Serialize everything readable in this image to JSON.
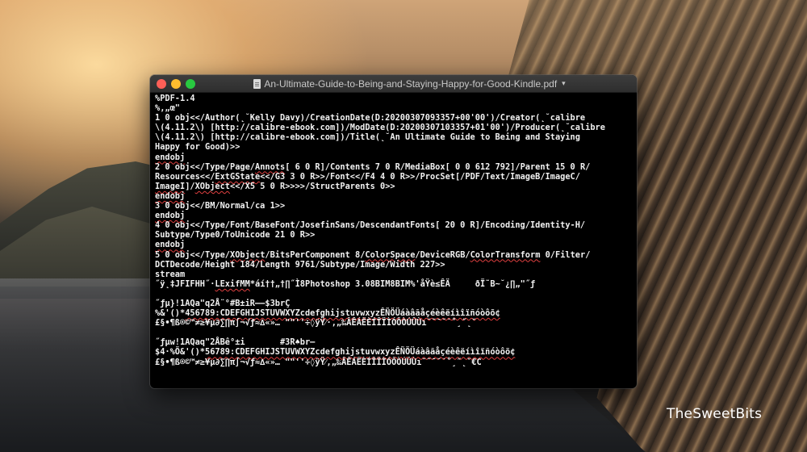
{
  "window": {
    "title": "An-Ultimate-Guide-to-Being-and-Staying-Happy-for-Good-Kindle.pdf",
    "title_icon": "document-icon",
    "dropdown_icon": "chevron-down-icon"
  },
  "watermark": "TheSweetBits",
  "colors": {
    "terminal_bg": "#000000",
    "terminal_text": "#f2f2f2",
    "close": "#fe5f57",
    "minimize": "#febc2e",
    "zoom": "#28c840",
    "spellcheck_underline": "#e04040"
  },
  "terminal_lines": [
    [
      "%PDF-1.4"
    ],
    [
      "%‚„œ\""
    ],
    [
      "1 0 obj<</Author(˛˘Kelly Davy)/CreationDate(D:20200307093357+00'00')/Creator(˛˘calibre"
    ],
    [
      "\\(4.11.2\\) [http://calibre-ebook.com])/ModDate(D:20200307103357+01'00')/Producer(˛˘calibre"
    ],
    [
      "\\(4.11.2\\) [http://calibre-ebook.com])/Title(˛˘An Ultimate Guide to Being and Staying"
    ],
    [
      "Happy for Good)>>"
    ],
    [
      {
        "t": "endobj",
        "sq": true
      }
    ],
    [
      "2 0 obj<</Type/Page/",
      {
        "t": "Annots",
        "sq": true
      },
      "[ 6 0 R]/Contents 7 0 R/MediaBox[ 0 0 612 792]/Parent 15 0 R/"
    ],
    [
      "Resources<</",
      {
        "t": "ExtGState",
        "sq": true
      },
      "<</G3 3 0 R>>/Font<</F4 4 0 R>>/ProcSet[/PDF/Text/ImageB/ImageC/"
    ],
    [
      {
        "t": "ImageI",
        "sq": true
      },
      "]/",
      {
        "t": "XObject",
        "sq": true
      },
      "<</X5 5 0 R>>>>/StructParents 0>>"
    ],
    [
      {
        "t": "endobj",
        "sq": true
      }
    ],
    [
      "3 0 obj<</BM/Normal/ca 1>>"
    ],
    [
      {
        "t": "endobj",
        "sq": true
      }
    ],
    [
      "4 0 obj<</Type/Font/BaseFont/JosefinSans/DescendantFonts[ 20 0 R]/Encoding/Identity-H/"
    ],
    [
      "Subtype/Type0/ToUnicode 21 0 R>>"
    ],
    [
      {
        "t": "endobj",
        "sq": true
      }
    ],
    [
      "5 0 obj<</Type/",
      {
        "t": "XObject",
        "sq": true
      },
      "/BitsPerComponent 8/",
      {
        "t": "ColorSpace",
        "sq": true
      },
      "/DeviceRGB/",
      {
        "t": "ColorTransform",
        "sq": true
      },
      " 0/Filter/"
    ],
    [
      "DCTDecode/Height 184/Length 9761/Subtype/Image/Width 227>>"
    ],
    [
      "stream"
    ],
    [
      "˝ÿ˛‡JFIFHH˝·",
      {
        "t": "LExifMM",
        "sq": true
      },
      "*áí††„†∏˝Ì8Photoshop 3.08BIM8BIM%'åŸè≤ÊÄ     ðÏ˜B~˘¿∏„\"˝ƒ"
    ],
    [
      ""
    ],
    [
      "˝ƒµ}!1AQa\"q2Å¨°#B±iR——$3brÇ"
    ],
    [
      "%&'()*",
      {
        "t": "456789:CDEFGHIJSTUVWXYZcdefghijstuvwxyzÊÑÖÜáàâãåçéèêëíìîïñóòôõ¢",
        "sq": true
      }
    ],
    [
      "£§•¶ß®©™≠≥¥µ∂∑∏π∫¬√ƒ≈∆«»… \"\"''÷◊ÿŸ⁄·‚„‰ÂÊÁËÈÍÎÏÌÓÔÒÚÛÙı˘˜¯˘˙˚¸˝˛ˇ"
    ],
    [
      ""
    ],
    [
      "˝ƒµw!1AQaq\"2ÅBê°±i       #3R♠br—"
    ],
    [
      "$4·%Ö&'()*",
      {
        "t": "56789:CDEFGHIJSTUVWXYZcdefghijstuvwxyzÊÑÖÜáàâãåçéèêëíìîïñóòôõ¢",
        "sq": true
      }
    ],
    [
      "£§•¶ß®©™≠≥¥µ∂∑∏π∫¬√ƒ≈∆«»… \"\"''÷◊ÿŸ⁄,„‰ÂÊÁËÈÍÎÏÌÓÔÒÚÛÙı˘˜¯˘˙˚¸˝˛ˇ€C"
    ]
  ]
}
